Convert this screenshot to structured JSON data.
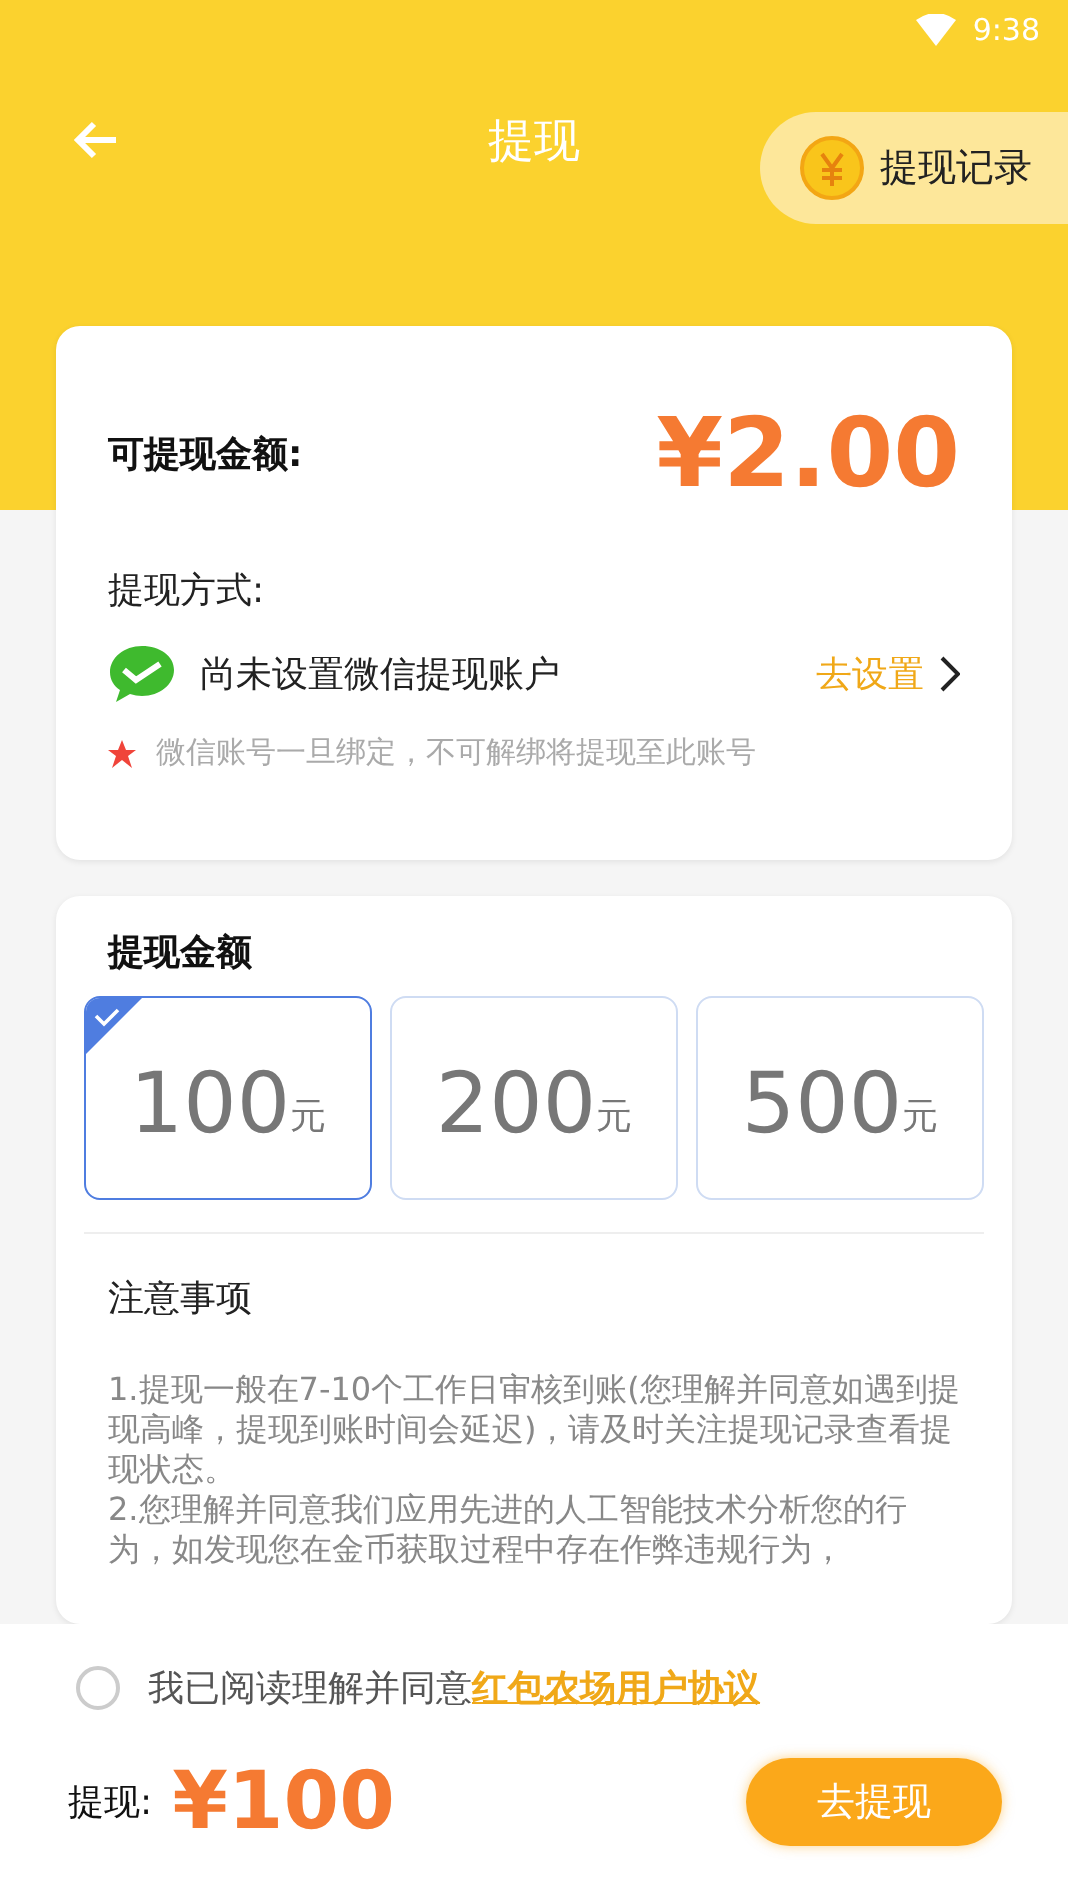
{
  "status_bar": {
    "time": "9:38"
  },
  "nav": {
    "title": "提现",
    "record_button": "提现记录"
  },
  "balance": {
    "label": "可提现金额:",
    "amount": "¥2.00"
  },
  "method": {
    "label": "提现方式:",
    "account": "尚未设置微信提现账户",
    "action": "去设置",
    "note": "微信账号一旦绑定，不可解绑将提现至此账号"
  },
  "amounts": {
    "title": "提现金额",
    "options": [
      {
        "value": "100",
        "unit": "元",
        "selected": true
      },
      {
        "value": "200",
        "unit": "元",
        "selected": false
      },
      {
        "value": "500",
        "unit": "元",
        "selected": false
      }
    ]
  },
  "notes": {
    "title": "注意事项",
    "items": [
      "1.提现一般在7-10个工作日审核到账(您理解并同意如遇到提现高峰，提现到账时间会延迟)，请及时关注提现记录查看提现状态。",
      " 2.您理解并同意我们应用先进的人工智能技术分析您的行为，如发现您在金币获取过程中存在作弊违规行为，"
    ]
  },
  "agreement": {
    "checked": false,
    "text": "我已阅读理解并同意",
    "link": "红包农场用户协议"
  },
  "footer": {
    "label": "提现:",
    "amount": "¥100",
    "button": "去提现"
  }
}
